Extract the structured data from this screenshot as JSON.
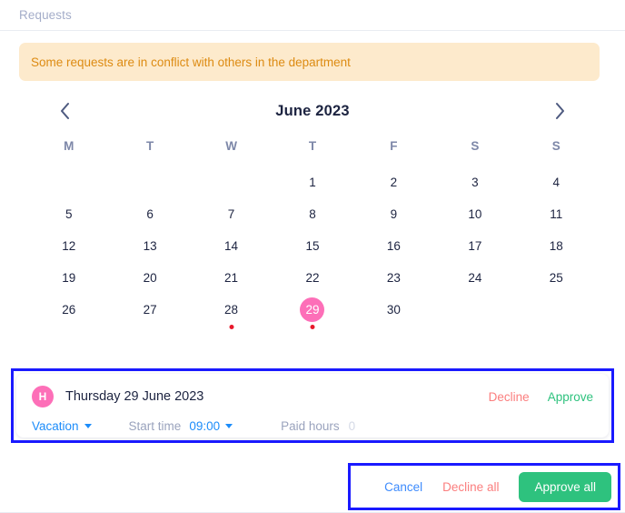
{
  "breadcrumb": {
    "label": "Requests"
  },
  "banner": {
    "message": "Some requests are in conflict with others in the department",
    "bg_color": "#fdeacc",
    "text_color": "#dd8b12"
  },
  "calendar": {
    "title": "June 2023",
    "prev_icon": "chevron-left-icon",
    "next_icon": "chevron-right-icon",
    "weekdays": [
      "M",
      "T",
      "W",
      "T",
      "F",
      "S",
      "S"
    ],
    "leading_blanks": 3,
    "days": [
      {
        "n": "1",
        "selected": false,
        "dot": false
      },
      {
        "n": "2",
        "selected": false,
        "dot": false
      },
      {
        "n": "3",
        "selected": false,
        "dot": false
      },
      {
        "n": "4",
        "selected": false,
        "dot": false
      },
      {
        "n": "5",
        "selected": false,
        "dot": false
      },
      {
        "n": "6",
        "selected": false,
        "dot": false
      },
      {
        "n": "7",
        "selected": false,
        "dot": false
      },
      {
        "n": "8",
        "selected": false,
        "dot": false
      },
      {
        "n": "9",
        "selected": false,
        "dot": false
      },
      {
        "n": "10",
        "selected": false,
        "dot": false
      },
      {
        "n": "11",
        "selected": false,
        "dot": false
      },
      {
        "n": "12",
        "selected": false,
        "dot": false
      },
      {
        "n": "13",
        "selected": false,
        "dot": false
      },
      {
        "n": "14",
        "selected": false,
        "dot": false
      },
      {
        "n": "15",
        "selected": false,
        "dot": false
      },
      {
        "n": "16",
        "selected": false,
        "dot": false
      },
      {
        "n": "17",
        "selected": false,
        "dot": false
      },
      {
        "n": "18",
        "selected": false,
        "dot": false
      },
      {
        "n": "19",
        "selected": false,
        "dot": false
      },
      {
        "n": "20",
        "selected": false,
        "dot": false
      },
      {
        "n": "21",
        "selected": false,
        "dot": false
      },
      {
        "n": "22",
        "selected": false,
        "dot": false
      },
      {
        "n": "23",
        "selected": false,
        "dot": false
      },
      {
        "n": "24",
        "selected": false,
        "dot": false
      },
      {
        "n": "25",
        "selected": false,
        "dot": false
      },
      {
        "n": "26",
        "selected": false,
        "dot": false
      },
      {
        "n": "27",
        "selected": false,
        "dot": false
      },
      {
        "n": "28",
        "selected": false,
        "dot": true
      },
      {
        "n": "29",
        "selected": true,
        "dot": true
      },
      {
        "n": "30",
        "selected": false,
        "dot": false
      }
    ],
    "selected_color": "#fd6fb8",
    "dot_color": "#e8192c"
  },
  "request_detail": {
    "avatar_initial": "H",
    "avatar_color": "#fd6fb8",
    "date": "Thursday 29 June 2023",
    "type_value": "Vacation",
    "start_time_label": "Start time",
    "start_time_value": "09:00",
    "paid_hours_label": "Paid hours",
    "paid_hours_value": "0",
    "decline_label": "Decline",
    "approve_label": "Approve",
    "decline_color": "#fb7e7e",
    "approve_color": "#2ec27e",
    "highlight_border": "#1a1aff"
  },
  "footer": {
    "cancel_label": "Cancel",
    "decline_all_label": "Decline all",
    "approve_all_label": "Approve all",
    "approve_all_bg": "#2ec27e",
    "highlight_border": "#1a1aff"
  }
}
